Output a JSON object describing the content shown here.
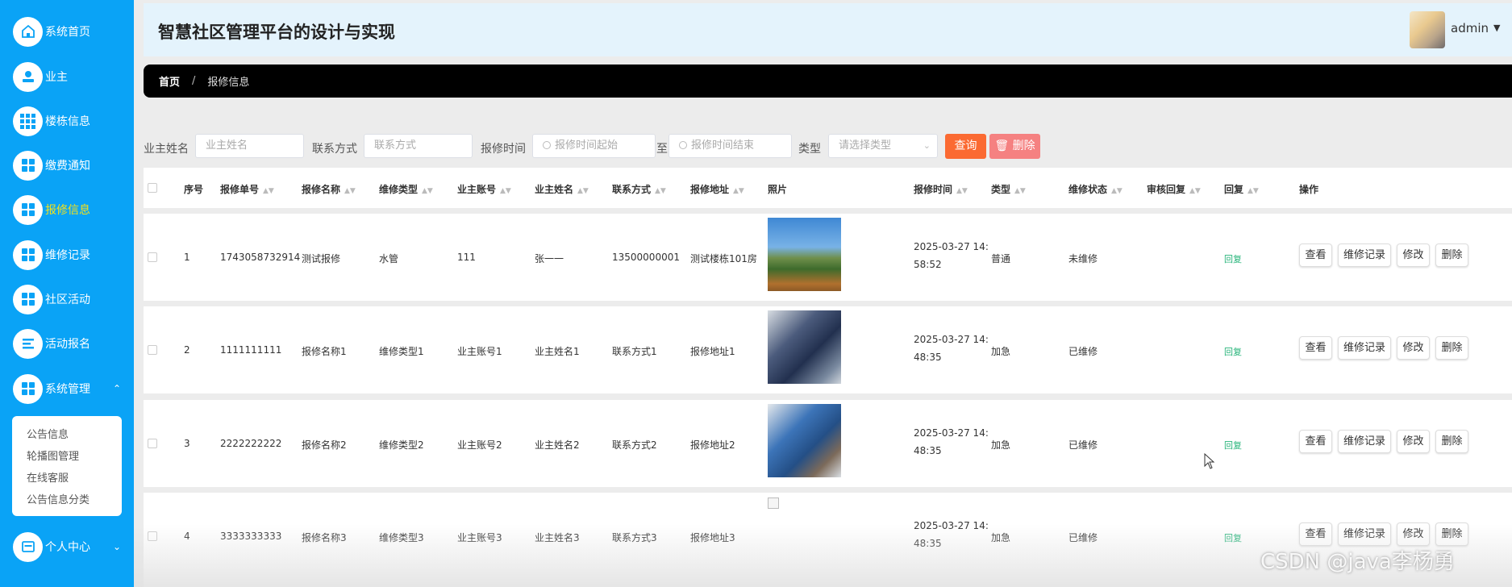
{
  "sidebar": {
    "items": [
      {
        "label": "系统首页",
        "icon": "home-icon"
      },
      {
        "label": "业主",
        "icon": "user-icon"
      },
      {
        "label": "楼栋信息",
        "icon": "grid-icon"
      },
      {
        "label": "缴费通知",
        "icon": "apps-icon"
      },
      {
        "label": "报修信息",
        "icon": "apps-icon"
      },
      {
        "label": "维修记录",
        "icon": "apps-icon"
      },
      {
        "label": "社区活动",
        "icon": "apps-icon"
      },
      {
        "label": "活动报名",
        "icon": "list-icon"
      },
      {
        "label": "系统管理",
        "icon": "apps-icon"
      },
      {
        "label": "个人中心",
        "icon": "profile-icon"
      }
    ],
    "active": "报修信息",
    "submenu": [
      "公告信息",
      "轮播图管理",
      "在线客服",
      "公告信息分类"
    ]
  },
  "header": {
    "title": "智慧社区管理平台的设计与实现",
    "user": "admin"
  },
  "breadcrumb": {
    "home": "首页",
    "separator": "/",
    "current": "报修信息"
  },
  "search": {
    "owner_name_label": "业主姓名",
    "owner_name_placeholder": "业主姓名",
    "contact_label": "联系方式",
    "contact_placeholder": "联系方式",
    "time_label": "报修时间",
    "time_start_placeholder": "报修时间起始",
    "time_to": "至",
    "time_end_placeholder": "报修时间结束",
    "type_label": "类型",
    "type_placeholder": "请选择类型",
    "search_button": "查询",
    "delete_button": "删除"
  },
  "table": {
    "headers": {
      "index": "序号",
      "order_no": "报修单号",
      "name": "报修名称",
      "repair_type": "维修类型",
      "owner_account": "业主账号",
      "owner_name": "业主姓名",
      "contact": "联系方式",
      "address": "报修地址",
      "photo": "照片",
      "time": "报修时间",
      "type": "类型",
      "status": "维修状态",
      "audit_reply": "审核回复",
      "reply": "回复",
      "actions": "操作"
    },
    "rows": [
      {
        "index": "1",
        "order_no": "1743058732914",
        "name": "测试报修",
        "repair_type": "水管",
        "owner_account": "111",
        "owner_name": "张一一",
        "contact": "13500000001",
        "address": "测试楼栋101房",
        "time_date": "2025-03-27 14:",
        "time_clock": "58:52",
        "type": "普通",
        "status": "未维修",
        "reply": "回复"
      },
      {
        "index": "2",
        "order_no": "1111111111",
        "name": "报修名称1",
        "repair_type": "维修类型1",
        "owner_account": "业主账号1",
        "owner_name": "业主姓名1",
        "contact": "联系方式1",
        "address": "报修地址1",
        "time_date": "2025-03-27 14:",
        "time_clock": "48:35",
        "type": "加急",
        "status": "已维修",
        "reply": "回复"
      },
      {
        "index": "3",
        "order_no": "2222222222",
        "name": "报修名称2",
        "repair_type": "维修类型2",
        "owner_account": "业主账号2",
        "owner_name": "业主姓名2",
        "contact": "联系方式2",
        "address": "报修地址2",
        "time_date": "2025-03-27 14:",
        "time_clock": "48:35",
        "type": "加急",
        "status": "已维修",
        "reply": "回复"
      },
      {
        "index": "4",
        "order_no": "3333333333",
        "name": "报修名称3",
        "repair_type": "维修类型3",
        "owner_account": "业主账号3",
        "owner_name": "业主姓名3",
        "contact": "联系方式3",
        "address": "报修地址3",
        "time_date": "2025-03-27 14:",
        "time_clock": "48:35",
        "type": "加急",
        "status": "已维修",
        "reply": "回复"
      }
    ],
    "actions": {
      "view": "查看",
      "records": "维修记录",
      "edit": "修改",
      "delete": "删除"
    }
  },
  "watermark": "CSDN @java李杨勇",
  "colors": {
    "sidebar": "#0aa3f6",
    "active_nav": "#f3e11b",
    "search_button": "#fb6a32",
    "delete_button": "#f58181",
    "reply_link": "#27b47a"
  }
}
